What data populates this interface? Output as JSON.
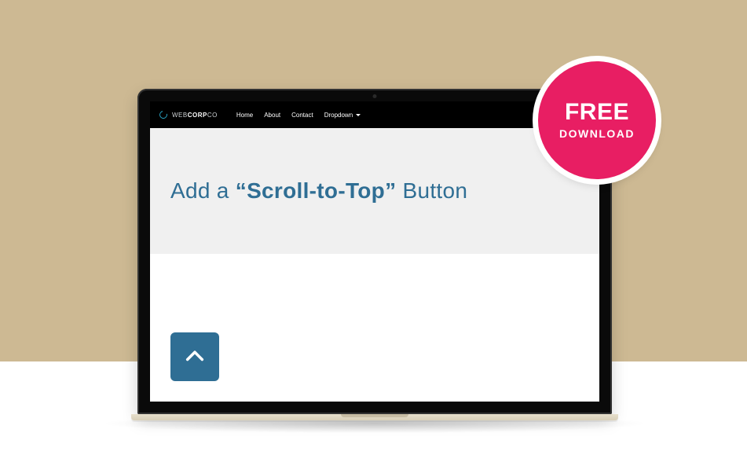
{
  "brand": {
    "name_prefix": "WEB",
    "name_bold": "CORP",
    "name_suffix": "CO"
  },
  "nav": {
    "items": [
      {
        "label": "Home"
      },
      {
        "label": "About"
      },
      {
        "label": "Contact"
      },
      {
        "label": "Dropdown"
      }
    ]
  },
  "hero": {
    "prefix": "Add a ",
    "strong": "“Scroll-to-Top”",
    "suffix": " Button"
  },
  "badge": {
    "top": "FREE",
    "bottom": "DOWNLOAD"
  },
  "colors": {
    "accent": "#2f6e94",
    "badge": "#e81e63",
    "bg": "#cdb993"
  }
}
